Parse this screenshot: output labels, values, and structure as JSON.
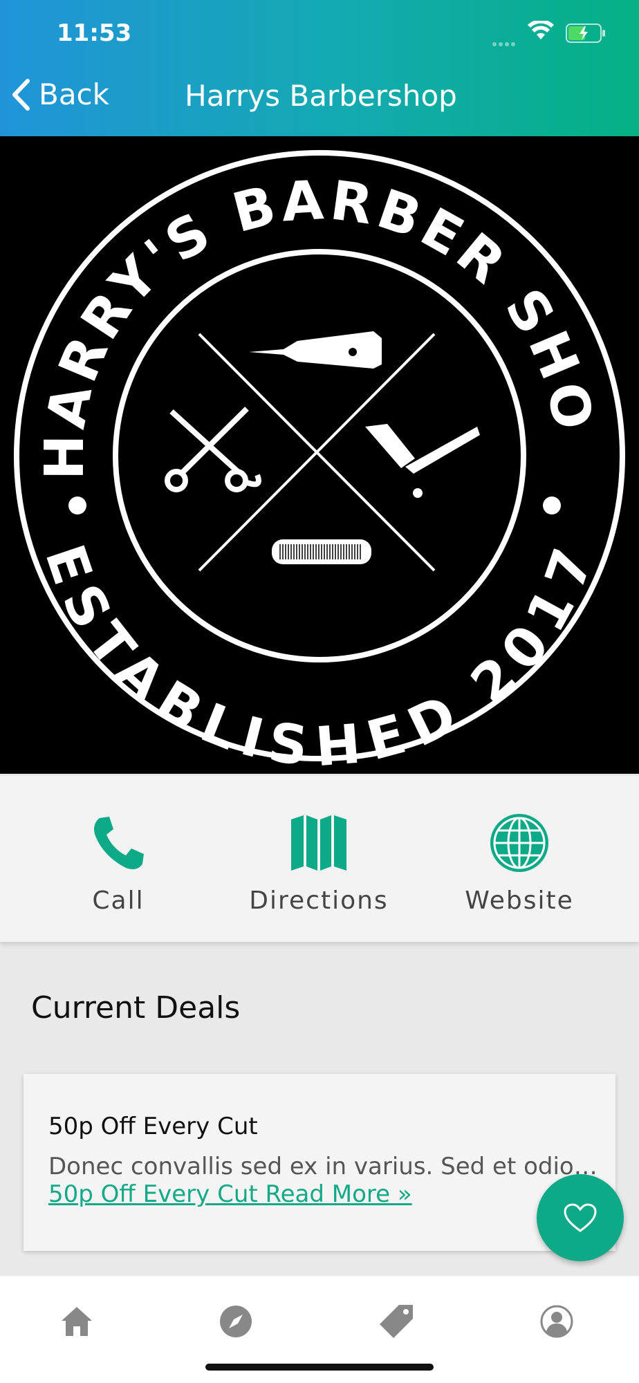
{
  "status_bar": {
    "time": "11:53"
  },
  "nav": {
    "back_label": "Back",
    "title": "Harrys Barbershop"
  },
  "hero": {
    "logo_top_text": "HARRY'S BARBER SHOP",
    "logo_bottom_text": "ESTABLISHED 2017"
  },
  "actions": [
    {
      "label": "Call",
      "icon": "phone-icon"
    },
    {
      "label": "Directions",
      "icon": "map-icon"
    },
    {
      "label": "Website",
      "icon": "globe-icon"
    }
  ],
  "deals": {
    "section_title": "Current Deals",
    "items": [
      {
        "title": "50p Off Every Cut",
        "description": "Donec convallis sed ex in varius. Sed et odio nec nisi porttitor",
        "link": "50p Off Every Cut Read More »"
      }
    ]
  },
  "tabbar": [
    {
      "icon": "home-icon"
    },
    {
      "icon": "compass-icon"
    },
    {
      "icon": "tag-icon"
    },
    {
      "icon": "profile-icon"
    }
  ],
  "colors": {
    "accent": "#0ea986",
    "header_start": "#2194d9",
    "header_end": "#04b084"
  }
}
